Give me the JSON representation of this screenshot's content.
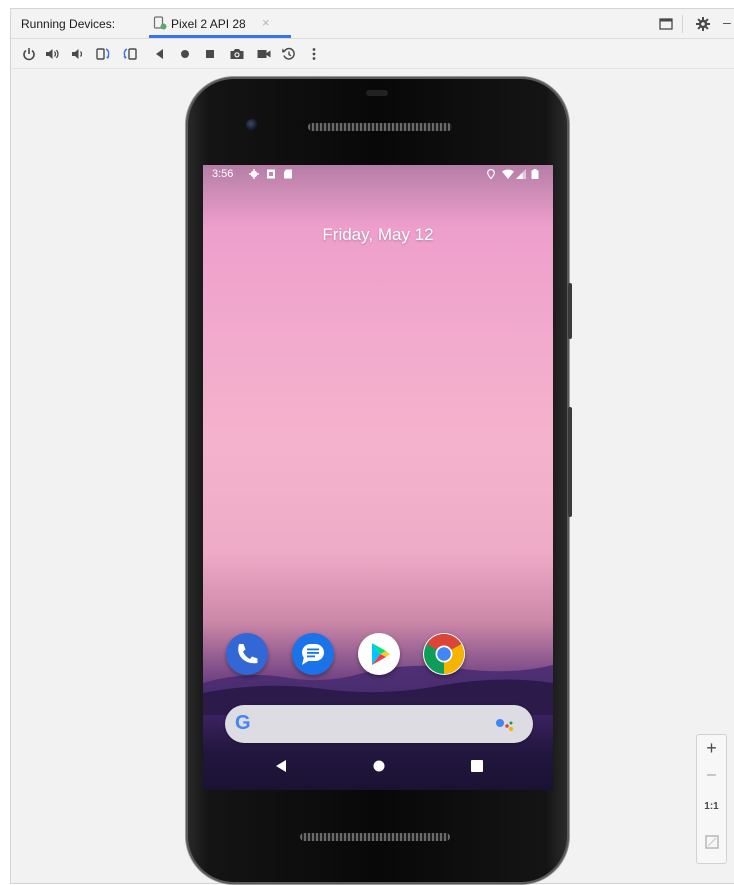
{
  "header": {
    "panel_title": "Running Devices:",
    "device_tab": {
      "label": "Pixel 2 API 28",
      "close_glyph": "×",
      "icon": "phone-device-icon"
    },
    "right_icons": [
      "window-restore-icon",
      "gear-icon",
      "minimize-icon"
    ],
    "minimize_glyph": "–"
  },
  "toolbar": {
    "icons": [
      "power-icon",
      "volume-up-icon",
      "volume-down-icon",
      "rotate-left-icon",
      "rotate-right-icon",
      "back-icon",
      "home-icon",
      "overview-icon",
      "camera-icon",
      "video-icon",
      "snapshot-restore-icon",
      "more-icon"
    ]
  },
  "device": {
    "status_bar": {
      "time": "3:56",
      "left_icons": [
        "settings-icon",
        "sim-icon",
        "sd-card-icon"
      ],
      "right_icons": [
        "location-icon",
        "wifi-icon",
        "signal-icon",
        "battery-icon"
      ]
    },
    "date": "Friday, May 12",
    "dock_apps": [
      "phone-app-icon",
      "messages-app-icon",
      "play-store-app-icon",
      "chrome-app-icon"
    ],
    "search_bar": {
      "logo": "G",
      "assistant_icon": "assistant-icon"
    },
    "nav_buttons": [
      "back-nav-icon",
      "home-nav-icon",
      "recents-nav-icon"
    ]
  },
  "zoom_controls": {
    "zoom_in": "+",
    "zoom_out": "–",
    "actual_size": "1:1",
    "fit": "fit-screen-icon"
  },
  "colors": {
    "accent": "#3574f0",
    "phone_app": "#3367d6",
    "messages_app": "#1a73e8",
    "chrome_red": "#db4437",
    "chrome_yellow": "#f4b400",
    "chrome_green": "#0f9d58"
  }
}
